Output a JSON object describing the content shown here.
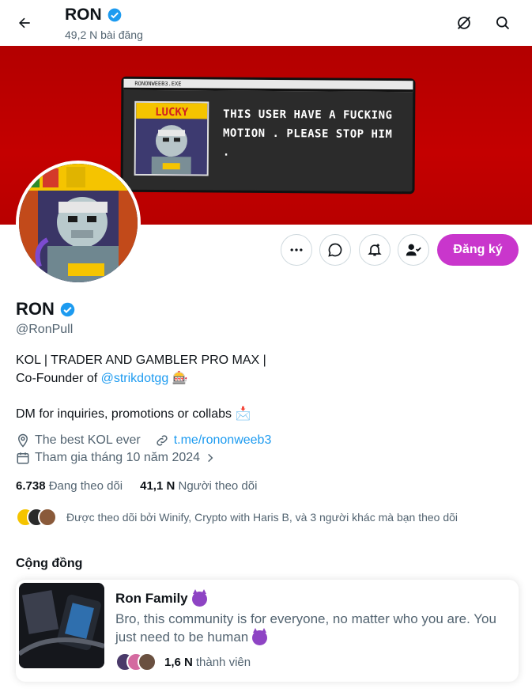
{
  "header": {
    "title": "RON",
    "post_count": "49,2 N bài đăng"
  },
  "banner": {
    "window_title": "RONONWEEB3.EXE",
    "thumb_label": "LUCKY",
    "message": "THIS USER HAVE A FUCKING MOTION . PLEASE STOP HIM ."
  },
  "actions": {
    "subscribe_label": "Đăng ký"
  },
  "profile": {
    "name": "RON",
    "handle": "@RonPull",
    "bio_line1": "KOL | TRADER AND GAMBLER PRO MAX |",
    "bio_line2_prefix": "Co-Founder of ",
    "bio_mention": "@strikdotgg",
    "bio_line2_emoji": "🎰",
    "bio_line3": "DM for inquiries, promotions or collabs",
    "bio_line3_emoji": "📩",
    "location": "The best KOL ever",
    "website": "t.me/rononweeb3",
    "joined": "Tham gia tháng 10 năm 2024"
  },
  "stats": {
    "following_count": "6.738",
    "following_label": "Đang theo dõi",
    "followers_count": "41,1 N",
    "followers_label": "Người theo dõi"
  },
  "followed_by": "Được theo dõi bởi Winify, Crypto with Haris B, và 3 người khác mà bạn theo dõi",
  "community_section": {
    "title": "Cộng đồng",
    "name": "Ron Family",
    "description": "Bro, this community is for everyone, no matter who you are. You just need to be human",
    "member_count": "1,6 N",
    "member_label": "thành viên"
  },
  "colors": {
    "accent": "#1d9bf0",
    "subscribe": "#c936cc",
    "banner": "#c40000",
    "muted": "#536471"
  },
  "icons": [
    "back-arrow-icon",
    "verified-icon",
    "grok-icon",
    "search-icon",
    "more-icon",
    "message-icon",
    "notify-icon",
    "follow-user-icon",
    "location-icon",
    "link-icon",
    "calendar-icon",
    "chevron-right-icon"
  ]
}
